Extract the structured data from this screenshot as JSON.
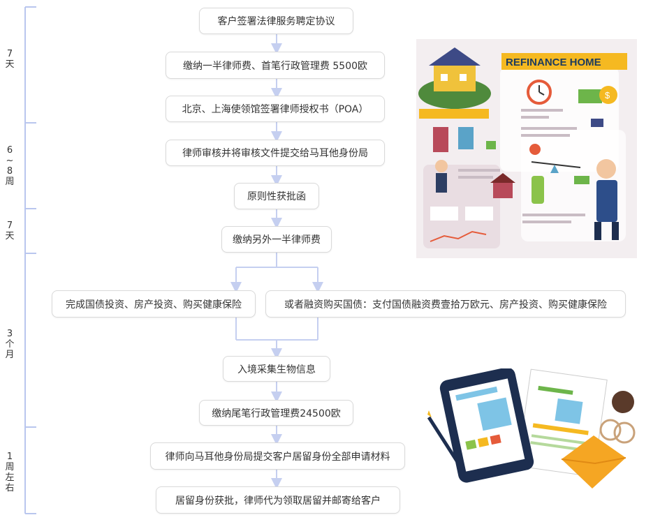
{
  "colors": {
    "connector": "#c5cff0",
    "timeline": "#b9c6ee",
    "box_border": "#d9d9d9",
    "text": "#333333"
  },
  "steps": {
    "s1": "客户签署法律服务聘定协议",
    "s2": "缴纳一半律师费、首笔行政管理费 5500欧",
    "s3": "北京、上海使领馆签署律师授权书（POA）",
    "s4": "律师审核并将审核文件提交给马耳他身份局",
    "s5": "原则性获批函",
    "s6": "缴纳另外一半律师费",
    "s7a": "完成国债投资、房产投资、购买健康保险",
    "s7b": "或者融资购买国债：支付国债融资费壹拾万欧元、房产投资、购买健康保险",
    "s8": "入境采集生物信息",
    "s9": "缴纳尾笔行政管理费24500欧",
    "s10": "律师向马耳他身份局提交客户居留身份全部申请材料",
    "s11": "居留身份获批，律师代为领取居留并邮寄给客户"
  },
  "phases": {
    "p1": [
      "7",
      "天"
    ],
    "p2": [
      "6",
      "~",
      "8",
      "周"
    ],
    "p3": [
      "7",
      "天"
    ],
    "p4": [
      "3",
      "个",
      "月"
    ],
    "p5": [
      "1",
      "周",
      "左",
      "右"
    ]
  },
  "illustration": {
    "banner_text": "REFINANCE HOME",
    "icons": [
      "house-icon",
      "clock-icon",
      "money-icon",
      "bank-icon",
      "businessman-icon",
      "tablet-icon",
      "envelope-icon",
      "pencil-icon",
      "coffee-cup-icon",
      "document-icon"
    ]
  }
}
